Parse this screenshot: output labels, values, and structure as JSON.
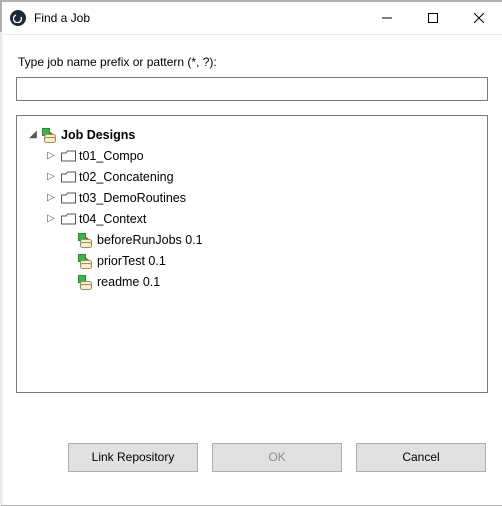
{
  "window": {
    "title": "Find a Job"
  },
  "prompt": "Type job name prefix or pattern (*, ?):",
  "search": {
    "value": "",
    "placeholder": ""
  },
  "tree": {
    "root_label": "Job Designs",
    "folders": [
      {
        "label": "t01_Compo"
      },
      {
        "label": "t02_Concatening"
      },
      {
        "label": "t03_DemoRoutines"
      },
      {
        "label": "t04_Context"
      }
    ],
    "jobs": [
      {
        "label": "beforeRunJobs 0.1"
      },
      {
        "label": "priorTest 0.1"
      },
      {
        "label": "readme 0.1"
      }
    ]
  },
  "buttons": {
    "link": "Link Repository",
    "ok": "OK",
    "cancel": "Cancel"
  },
  "icons": {
    "app": "app-icon",
    "minimize": "minimize-icon",
    "maximize": "maximize-icon",
    "close": "close-icon",
    "expander_open": "chevron-down-icon",
    "expander_closed": "chevron-right-icon",
    "folder": "folder-icon",
    "job": "job-icon"
  }
}
